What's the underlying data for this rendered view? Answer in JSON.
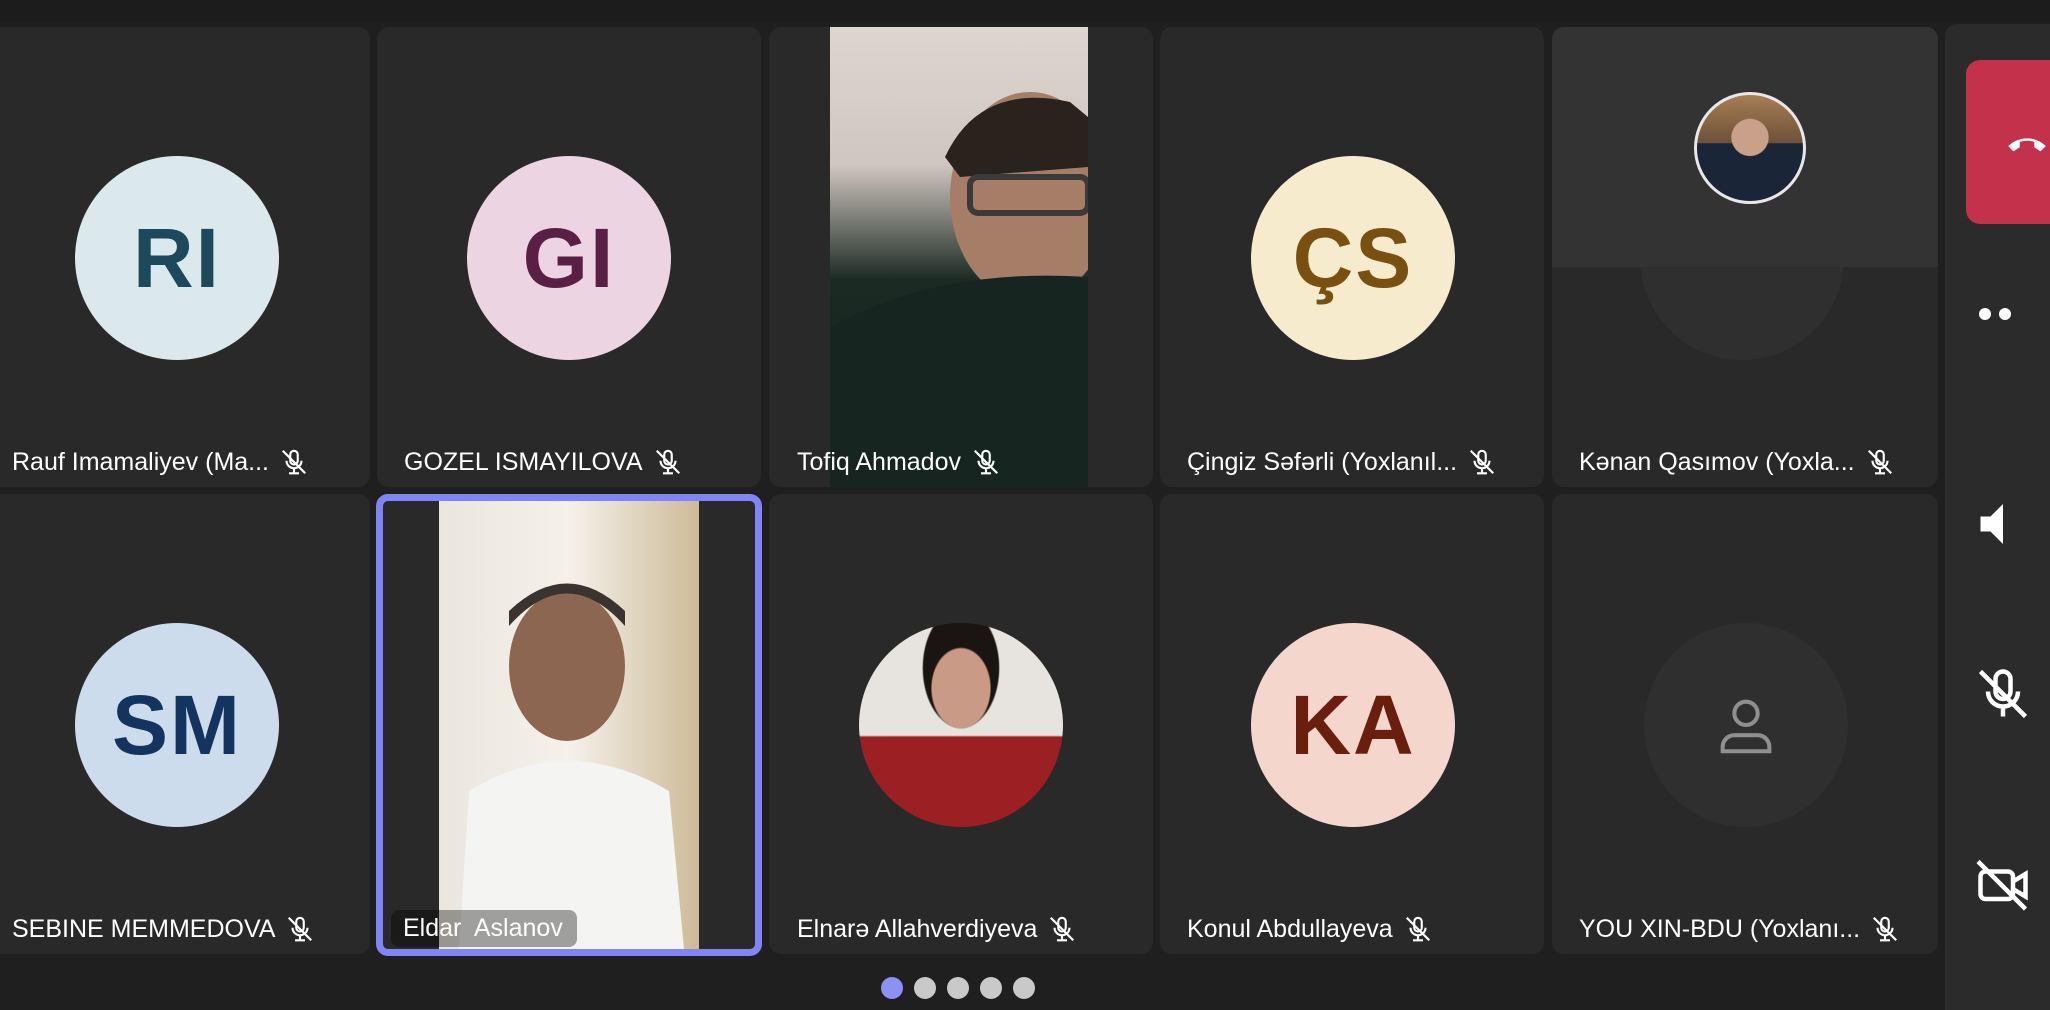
{
  "participants": [
    {
      "name": "Rauf Imamaliyev (Ma...",
      "initials": "RI",
      "avatar_bg": "#dbe8ec",
      "avatar_fg": "#1c4a5c",
      "muted": true
    },
    {
      "name": "GOZEL ISMAYILOVA",
      "initials": "GI",
      "avatar_bg": "#ecd4e3",
      "avatar_fg": "#5a1f45",
      "muted": true
    },
    {
      "name": "Tofiq Ahmadov",
      "type": "video",
      "muted": true
    },
    {
      "name": "Çingiz Səfərli (Yoxlanıl...",
      "initials": "ÇS",
      "avatar_bg": "#f7ebcd",
      "avatar_fg": "#7a5010",
      "muted": true
    },
    {
      "name": "Kənan Qasımov (Yoxla...",
      "type": "photo-avatar",
      "muted": true
    },
    {
      "name": "SEBINE MEMMEDOVA",
      "initials": "SM",
      "avatar_bg": "#ccdcec",
      "avatar_fg": "#12345e",
      "muted": true
    },
    {
      "name": "Eldar  Aslanov",
      "type": "video",
      "active_speaker": true,
      "muted": false
    },
    {
      "name": "Elnarə Allahverdiyeva",
      "type": "photo-avatar",
      "muted": true
    },
    {
      "name": "Konul Abdullayeva",
      "initials": "KA",
      "avatar_bg": "#f4d6cd",
      "avatar_fg": "#6a1f0e",
      "muted": true
    },
    {
      "name": "YOU XIN-BDU (Yoxlanı...",
      "type": "placeholder-avatar",
      "muted": true
    }
  ],
  "pagination": {
    "pages": 5,
    "current": 1
  },
  "colors": {
    "accent": "#7f85f5",
    "hangup": "#c4314b",
    "tile": "#292929",
    "background": "#1f1f1f"
  },
  "sidebar_icons": [
    "hangup-icon",
    "more-options-icon",
    "speaker-icon",
    "mic-off-icon",
    "camera-off-icon"
  ]
}
